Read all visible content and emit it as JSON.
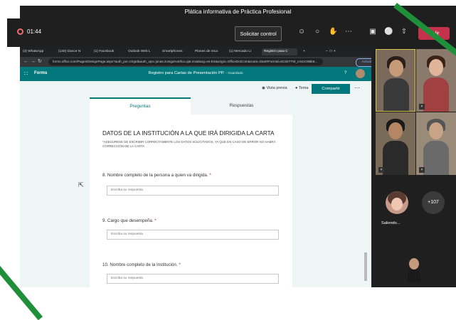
{
  "meeting": {
    "title": "Plática informativa de Práctica Profesional",
    "timer": "01:44",
    "request_control_label": "Solicitar control",
    "leave_label": "Salir"
  },
  "browser": {
    "tabs": [
      {
        "label": "(3) WhatsApp"
      },
      {
        "label": "(140) Dance N"
      },
      {
        "label": "(1) Facebook"
      },
      {
        "label": "Outlook Web L"
      },
      {
        "label": "Smartphones"
      },
      {
        "label": "Planes de reca"
      },
      {
        "label": "(1) Mercado Li"
      },
      {
        "label": "Registro para C",
        "active": true
      }
    ],
    "url": "forms.office.com/Pages/DesignPage.aspx?auth_pvr=OrgId&auth_upn=jonas.zuniga%40fca.ujat.mx&lang=es-ES&origin=OfficeDotCom&route=Start#FormId=8CSkTTW_mSUO0Bk6...",
    "update_label": "Actualizar"
  },
  "forms": {
    "brand": "Forms",
    "doc_title": "Registro para Cartas de Presentación PP.",
    "saved_status": "- Guardado",
    "help": "?",
    "preview_label": "Vista previa",
    "theme_label": "Tema",
    "share_label": "Compartir",
    "tab_questions": "Preguntas",
    "tab_responses": "Respuestas",
    "section_title": "DATOS DE LA INSTITUCIÓN A LA QUE IRÁ DIRIGIDA LA CARTA",
    "section_subtitle": "*ASEGURESE DE ESCRIBIR CORRECTAMENTE LOS DATOS SOLICITADOS, YA QUE EN CASO DE ERROR NO HABRÁ CORRECCIÓN DE LA CARTA",
    "questions": [
      {
        "label": "8. Nombre completo de la persona a quien va dirigida.",
        "required": "*",
        "placeholder": "Escriba su respuesta"
      },
      {
        "label": "9. Cargo que desempeña.",
        "required": "*",
        "placeholder": "Escriba su respuesta"
      },
      {
        "label": "10. Nombre completo de la Institución.",
        "required": "*",
        "placeholder": "Escriba su respuesta"
      }
    ]
  },
  "participants": {
    "more_count": "+107",
    "participant_name": "Saliendo..."
  },
  "colors": {
    "teams_bar": "#1f1f1f",
    "forms_teal": "#03787c",
    "leave_red": "#c4314b",
    "accent_green": "#1f8f3a"
  }
}
